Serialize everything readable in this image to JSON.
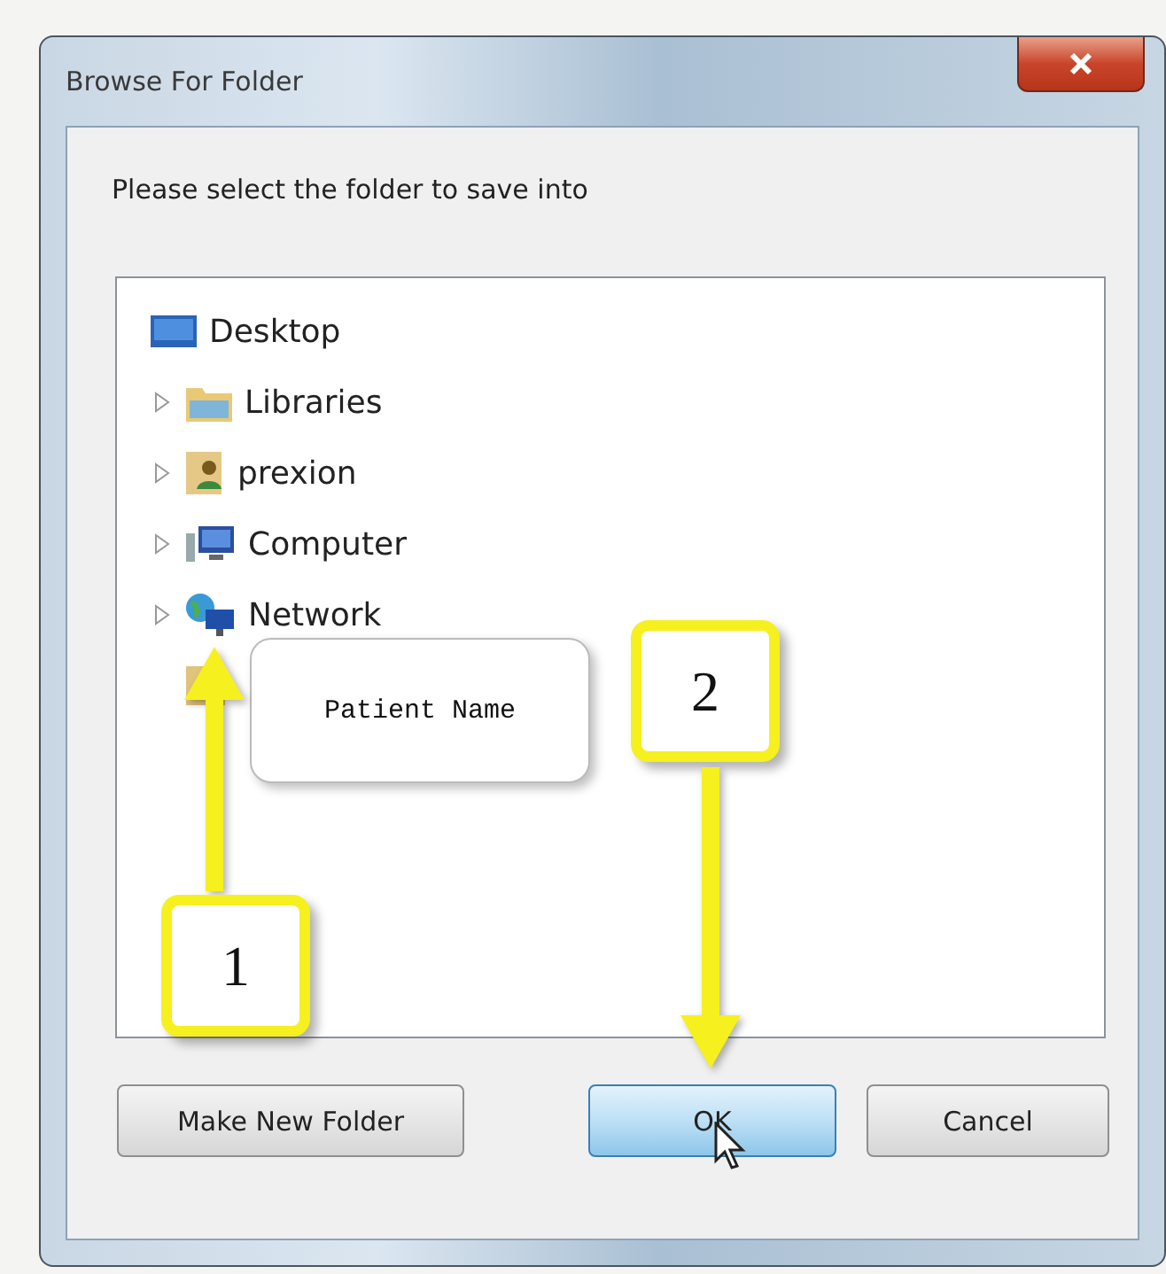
{
  "window": {
    "title": "Browse For Folder"
  },
  "instruction": "Please select the folder to save into",
  "tree": {
    "items": [
      {
        "label": "Desktop",
        "kind": "desktop",
        "children": [
          {
            "label": "Libraries",
            "kind": "libraries",
            "expanded": false
          },
          {
            "label": "prexion",
            "kind": "user",
            "expanded": false
          },
          {
            "label": "Computer",
            "kind": "computer",
            "expanded": false
          },
          {
            "label": "Network",
            "kind": "network",
            "expanded": false
          }
        ]
      }
    ]
  },
  "annotations": {
    "label": "Patient Name",
    "steps": [
      "1",
      "2"
    ]
  },
  "buttons": [
    {
      "label": "Make New Folder",
      "highlighted": false
    },
    {
      "label": "OK",
      "highlighted": true
    },
    {
      "label": "Cancel",
      "highlighted": false
    }
  ]
}
